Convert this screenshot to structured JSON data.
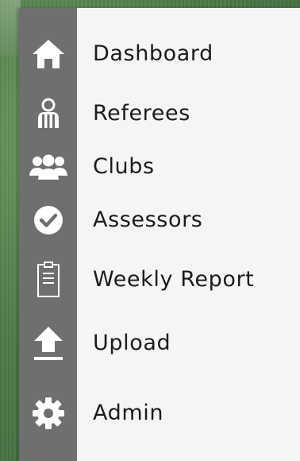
{
  "menu": {
    "items": [
      {
        "label": "Dashboard",
        "icon": "home-icon"
      },
      {
        "label": "Referees",
        "icon": "referee-icon"
      },
      {
        "label": "Clubs",
        "icon": "group-icon"
      },
      {
        "label": "Assessors",
        "icon": "check-circle-icon"
      },
      {
        "label": "Weekly Report",
        "icon": "clipboard-icon"
      },
      {
        "label": "Upload",
        "icon": "upload-icon"
      },
      {
        "label": "Admin",
        "icon": "gear-icon"
      }
    ]
  },
  "colors": {
    "rail": "#6f6f6f",
    "panel": "#f5f5f5",
    "icon": "#ffffff",
    "text": "#1b1b1b"
  }
}
